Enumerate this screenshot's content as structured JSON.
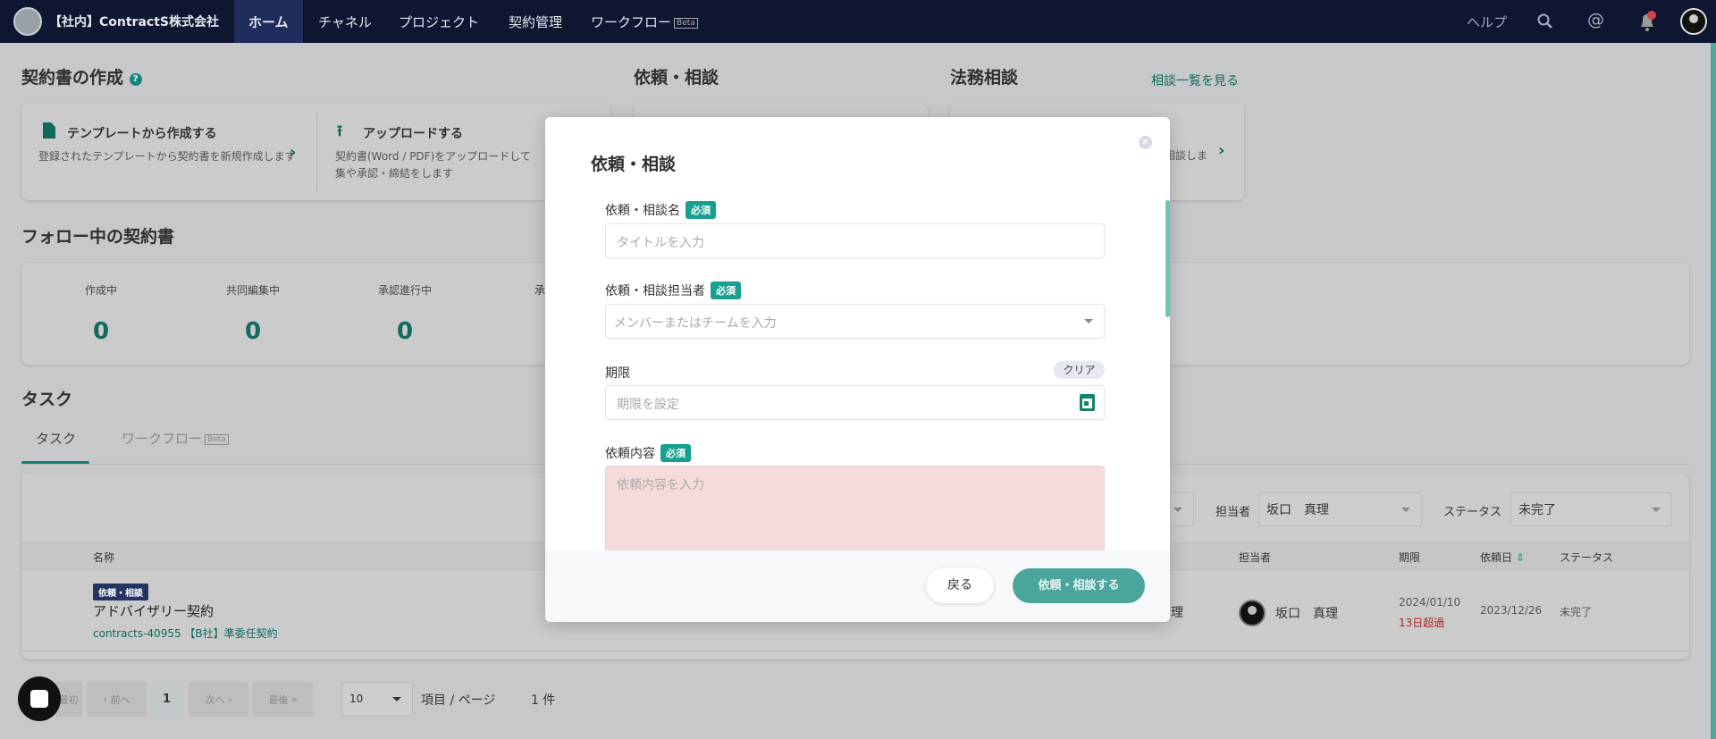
{
  "nav": {
    "company": "【社内】ContractS株式会社",
    "items": [
      "ホーム",
      "チャネル",
      "プロジェクト",
      "契約管理",
      "ワークフロー"
    ],
    "beta": "Beta",
    "help": "ヘルプ"
  },
  "create": {
    "title": "契約書の作成",
    "template_title": "テンプレートから作成する",
    "template_desc": "登録されたテンプレートから契約書を新規作成します",
    "upload_title": "アップロードする",
    "upload_desc": "契約書(Word / PDF)をアップロードして",
    "upload_desc2": "集や承認・締結をします"
  },
  "request": {
    "title": "依頼・相談"
  },
  "legal": {
    "title": "法務相談",
    "link": "相談一覧を見る",
    "desc_partial": "相談しま"
  },
  "follow": {
    "title": "フォロー中の契約書",
    "stats": [
      {
        "label": "作成中",
        "value": "0"
      },
      {
        "label": "共同編集中",
        "value": "0"
      },
      {
        "label": "承認進行中",
        "value": "0"
      },
      {
        "label": "承",
        "value": ""
      }
    ]
  },
  "tasks": {
    "title": "タスク",
    "tabs": [
      "タスク",
      "ワークフロー"
    ],
    "beta": "Beta",
    "filters": {
      "assignee_label": "担当者",
      "assignee_value": "坂口　真理",
      "status_label": "ステータス",
      "status_value": "未完了"
    },
    "columns": {
      "name": "名称",
      "assignee": "担当者",
      "due": "期限",
      "requested": "依頼日",
      "status": "ステータス"
    },
    "rows": [
      {
        "badge": "依頼・相談",
        "title": "アドバイザリー契約",
        "sub": "contracts-40955 【B社】準委任契約",
        "partial": "理",
        "assignee": "坂口　真理",
        "due": "2024/01/10",
        "overdue": "13日超過",
        "requested": "2023/12/26",
        "status": "未完了"
      }
    ],
    "pagination": {
      "first": "最初",
      "prev": "前へ",
      "page": "1",
      "next": "次へ",
      "last": "最後",
      "per_page": "10",
      "per_page_label": "項目 / ページ",
      "count": "1 件"
    }
  },
  "modal": {
    "title": "依頼・相談",
    "required": "必須",
    "name_label": "依頼・相談名",
    "name_placeholder": "タイトルを入力",
    "assignee_label": "依頼・相談担当者",
    "assignee_placeholder": "メンバーまたはチームを入力",
    "due_label": "期限",
    "clear": "クリア",
    "due_placeholder": "期限を設定",
    "content_label": "依頼内容",
    "content_placeholder": "依頼内容を入力",
    "back": "戻る",
    "submit": "依頼・相談する"
  },
  "colors": {
    "accent": "#0e6b5e",
    "required": "#17a08f",
    "nav": "#0f1631",
    "overdue": "#b22222"
  }
}
